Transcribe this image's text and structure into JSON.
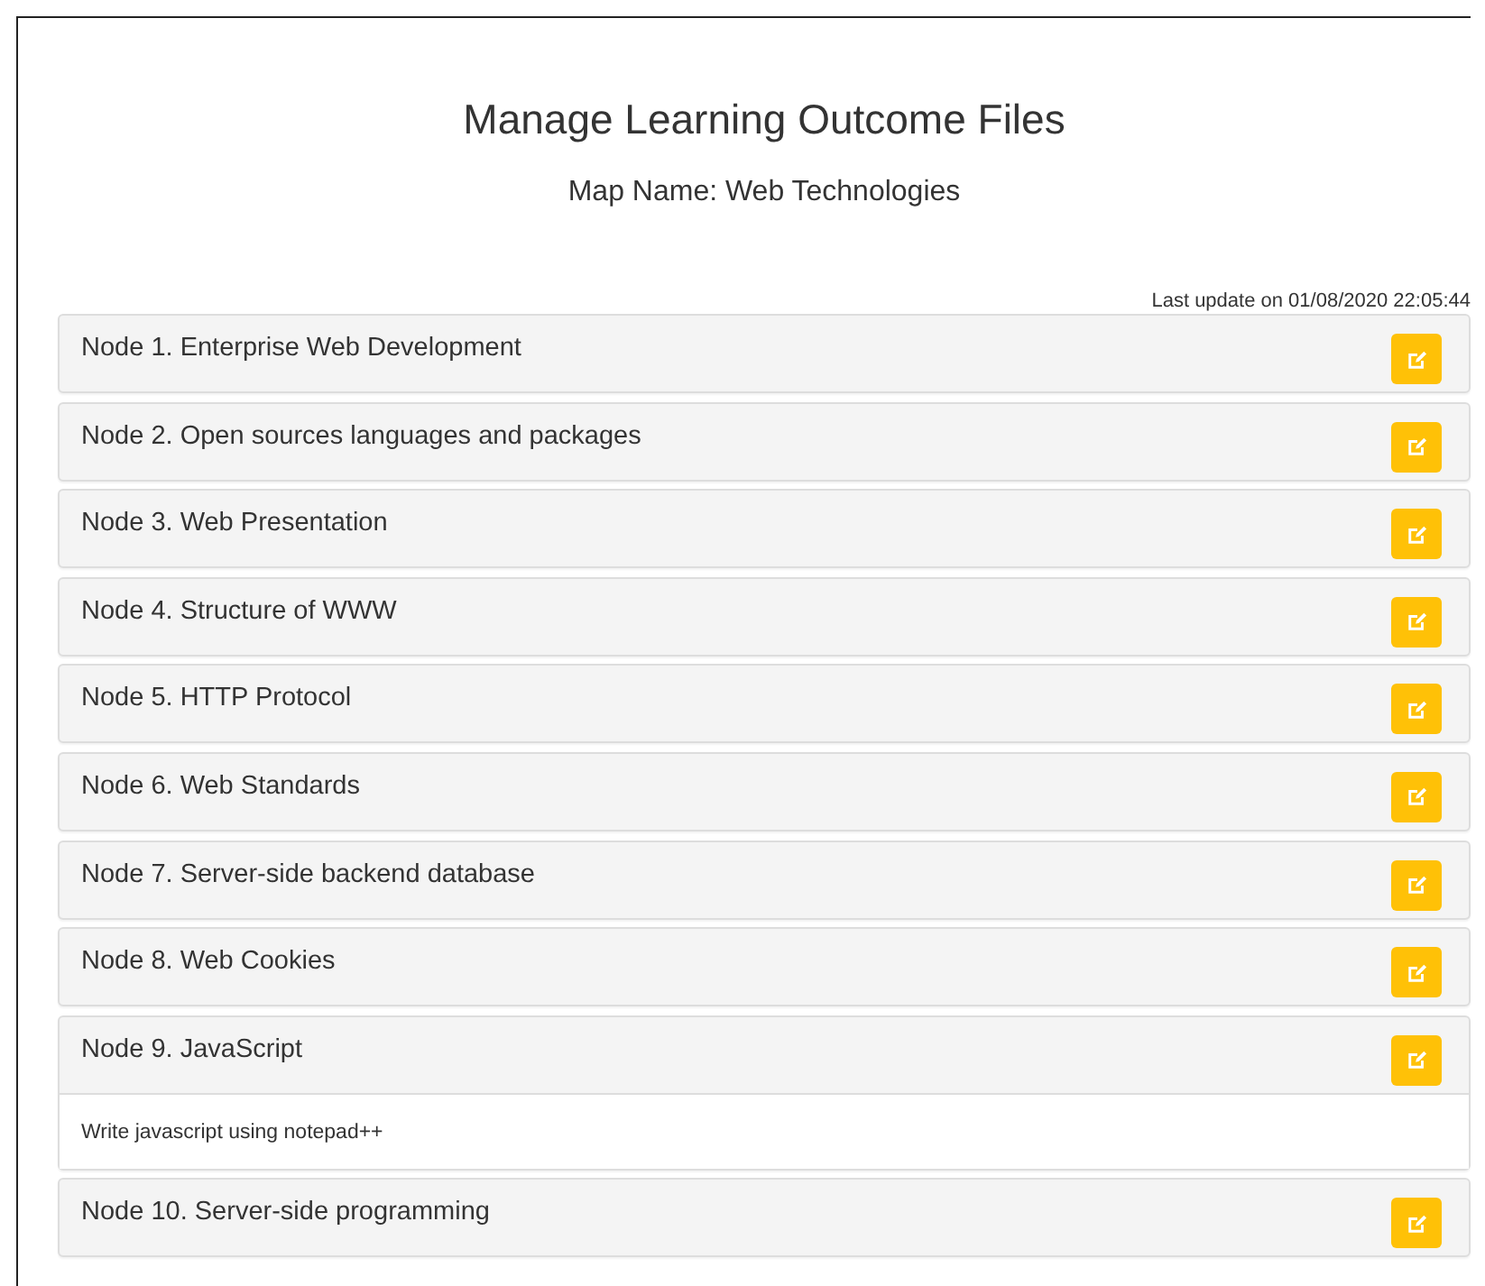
{
  "title": "Manage Learning Outcome Files",
  "subtitle": "Map Name: Web Technologies",
  "last_update": "Last update on 01/08/2020 22:05:44",
  "nodes": [
    {
      "title": "Node 1. Enterprise Web Development",
      "expanded": false
    },
    {
      "title": "Node 2. Open sources languages and packages",
      "expanded": false
    },
    {
      "title": "Node 3. Web Presentation",
      "expanded": false
    },
    {
      "title": "Node 4. Structure of WWW",
      "expanded": false
    },
    {
      "title": "Node 5. HTTP Protocol",
      "expanded": false
    },
    {
      "title": "Node 6. Web Standards",
      "expanded": false
    },
    {
      "title": "Node 7. Server-side backend database",
      "expanded": false
    },
    {
      "title": "Node 8. Web Cookies",
      "expanded": false
    },
    {
      "title": "Node 9. JavaScript",
      "expanded": true,
      "body": "Write javascript using notepad++"
    },
    {
      "title": "Node 10. Server-side programming",
      "expanded": false
    }
  ]
}
